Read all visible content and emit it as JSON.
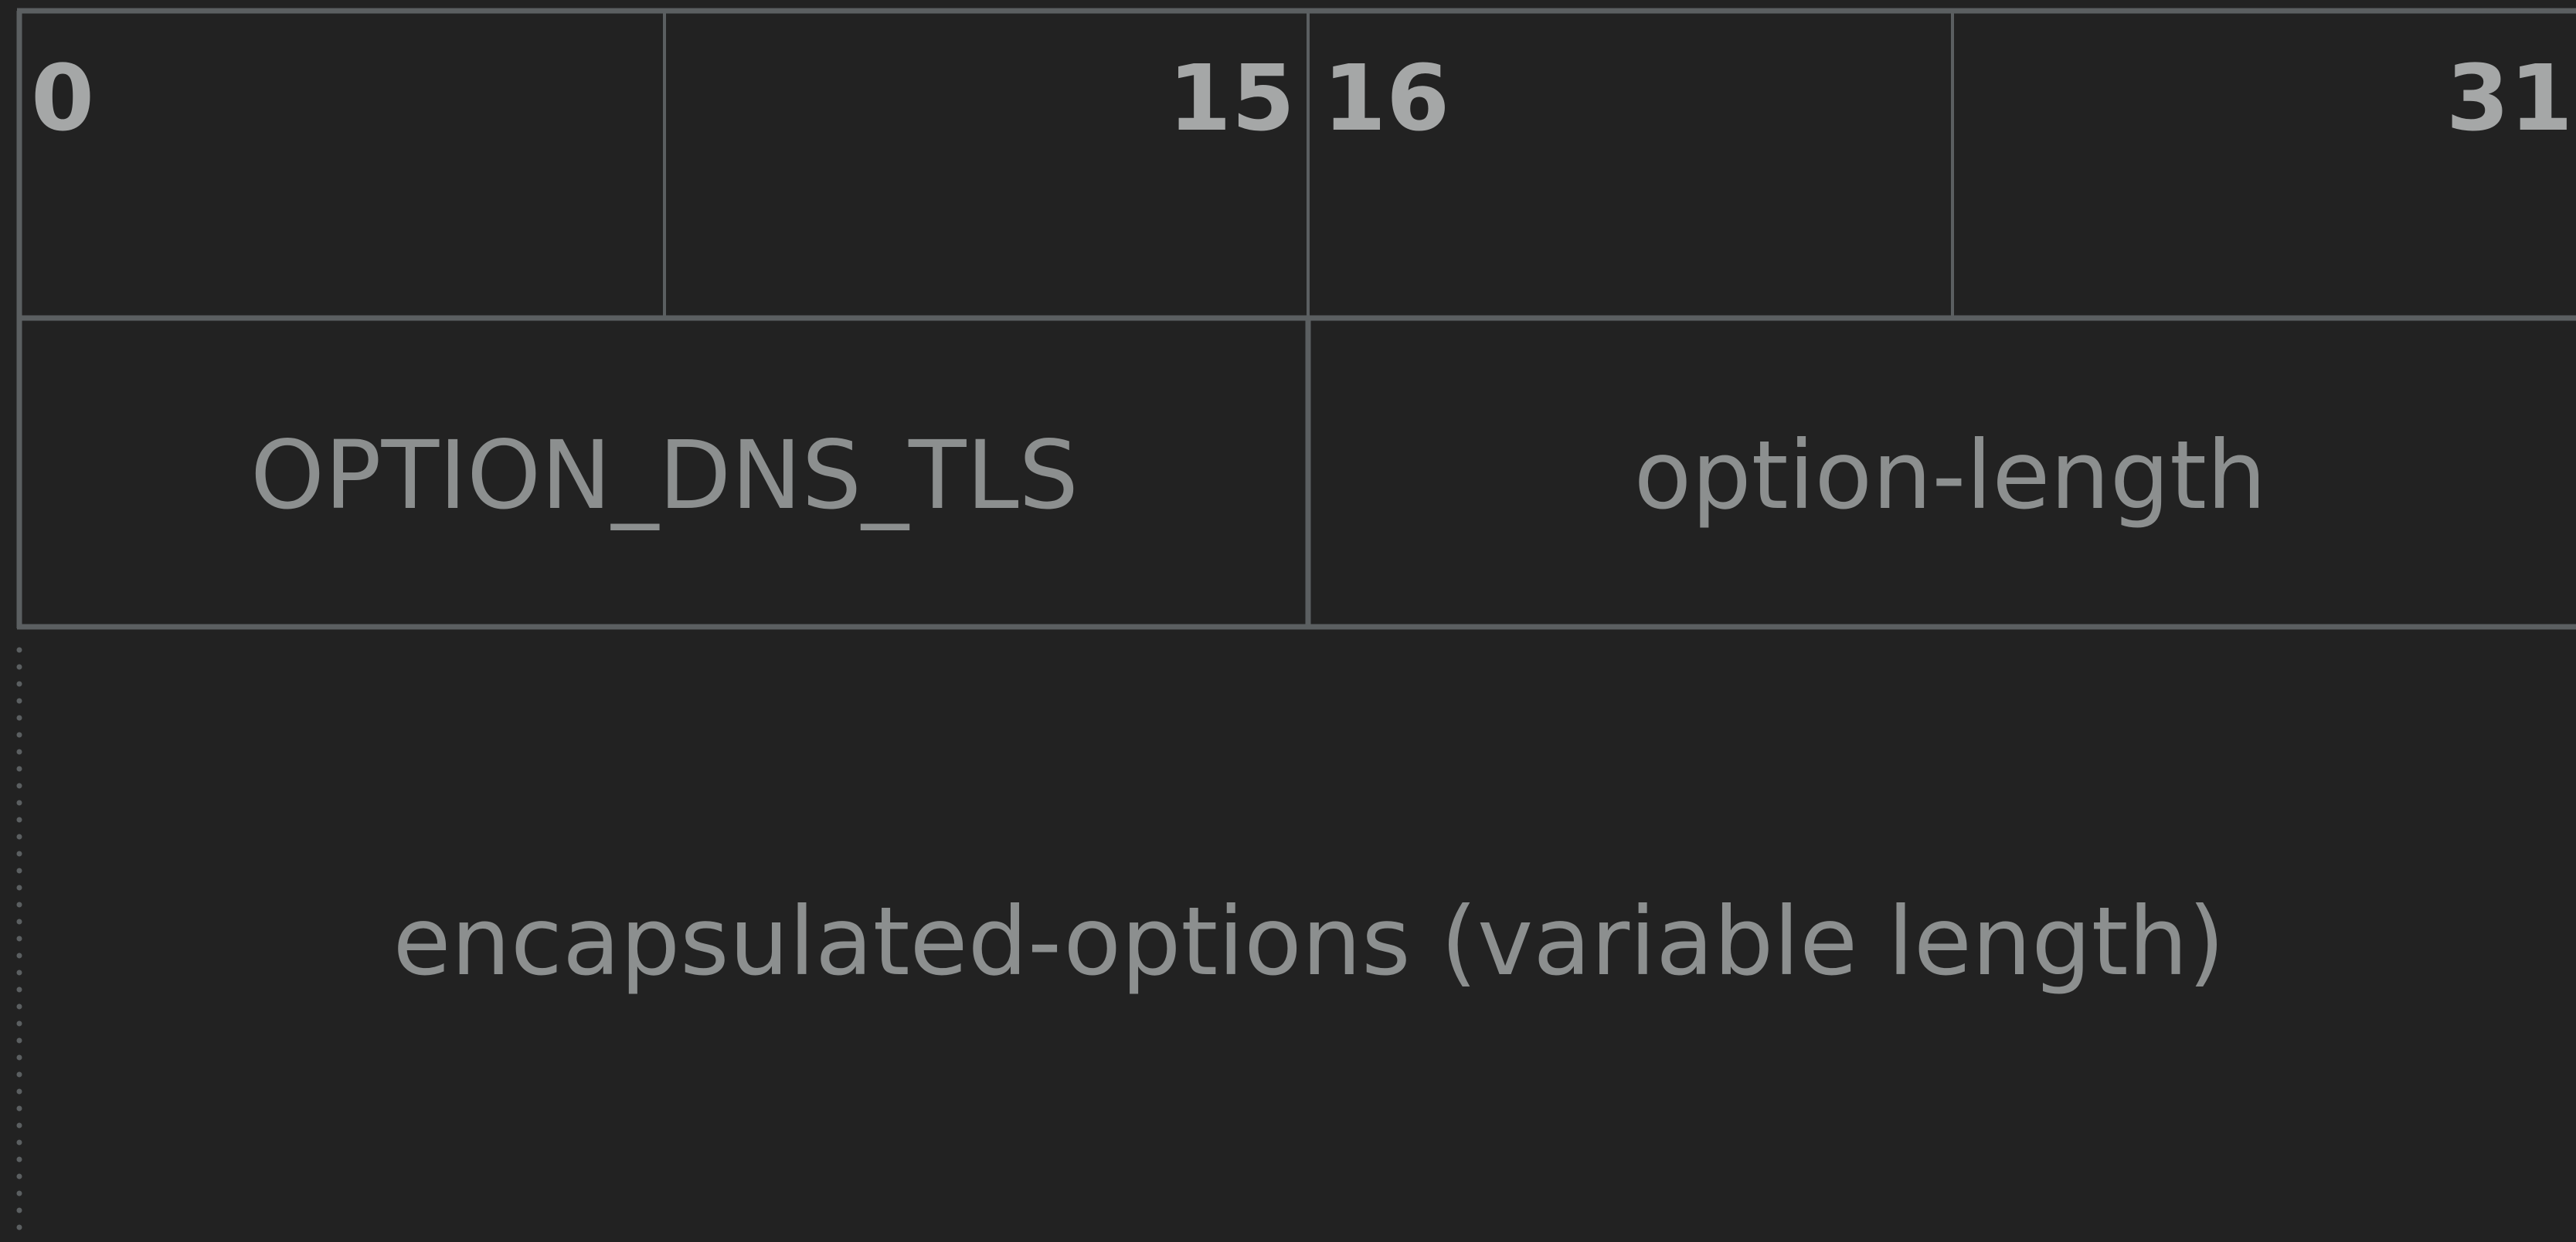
{
  "bit_header": {
    "start_left": "0",
    "end_left": "15",
    "start_right": "16",
    "end_right": "31"
  },
  "fields": {
    "option_code": "OPTION_DNS_TLS",
    "option_length": "option-length",
    "encapsulated": "encapsulated-options (variable length)"
  },
  "colors": {
    "background": "#222222",
    "grid_line": "#5b5f61",
    "bit_number": "#a5a7a7",
    "field_text": "#8c8f8f"
  }
}
